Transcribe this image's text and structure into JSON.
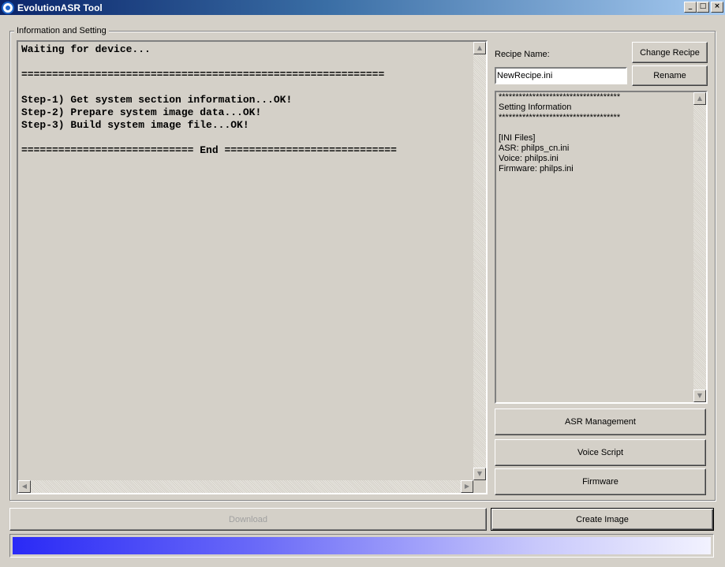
{
  "window": {
    "title": "EvolutionASR Tool"
  },
  "window_buttons": {
    "minimize": "_",
    "maximize": "□",
    "close": "×"
  },
  "group": {
    "label": "Information and Setting"
  },
  "log": {
    "text": "Waiting for device...\n\n===========================================================\n\nStep-1) Get system section information...OK!\nStep-2) Prepare system image data...OK!\nStep-3) Build system image file...OK!\n\n============================ End ============================"
  },
  "recipe": {
    "label": "Recipe Name:",
    "value": "NewRecipe.ini",
    "change_label": "Change Recipe",
    "rename_label": "Rename"
  },
  "settings_info": {
    "text": "************************************\nSetting Information\n************************************\n\n[INI Files]\nASR: philps_cn.ini\nVoice: philps.ini\nFirmware: philps.ini"
  },
  "buttons": {
    "asr_management": "ASR Management",
    "voice_script": "Voice Script",
    "firmware": "Firmware",
    "download": "Download",
    "create_image": "Create Image"
  },
  "progress": {
    "value": 1.0
  },
  "colors": {
    "title_start": "#0a246a",
    "title_end": "#a6caf0",
    "progress_start": "#2a2af6",
    "progress_end": "#f2f2fe",
    "face": "#d4d0c8"
  }
}
